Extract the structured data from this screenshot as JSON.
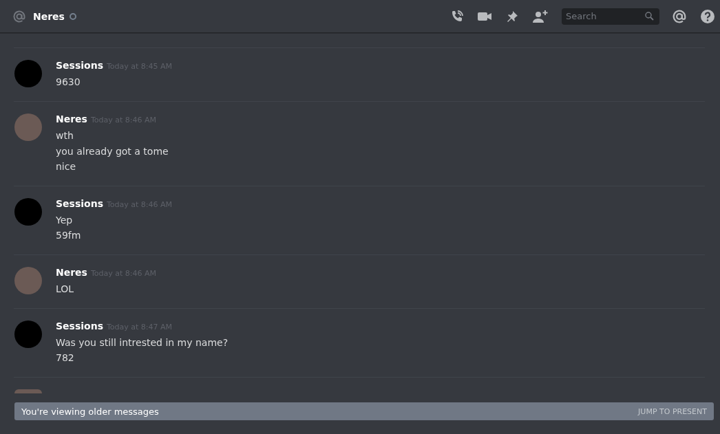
{
  "header": {
    "channel_name": "Neres",
    "online": false,
    "search": {
      "placeholder": "Search"
    }
  },
  "messages": [
    {
      "author": "Sessions",
      "kind": "dark",
      "timestamp": "Today at 8:45 AM",
      "lines": [
        "9630"
      ]
    },
    {
      "author": "Neres",
      "kind": "photo",
      "timestamp": "Today at 8:46 AM",
      "lines": [
        "wth",
        "you already got a tome",
        "nice"
      ]
    },
    {
      "author": "Sessions",
      "kind": "dark",
      "timestamp": "Today at 8:46 AM",
      "lines": [
        "Yep",
        "59fm"
      ]
    },
    {
      "author": "Neres",
      "kind": "photo",
      "timestamp": "Today at 8:46 AM",
      "lines": [
        "LOL"
      ]
    },
    {
      "author": "Sessions",
      "kind": "dark",
      "timestamp": "Today at 8:47 AM",
      "lines": [
        "Was you still intrested in my name?",
        "782"
      ]
    }
  ],
  "older_banner": {
    "text": "You're viewing older messages",
    "action": "JUMP TO PRESENT"
  }
}
